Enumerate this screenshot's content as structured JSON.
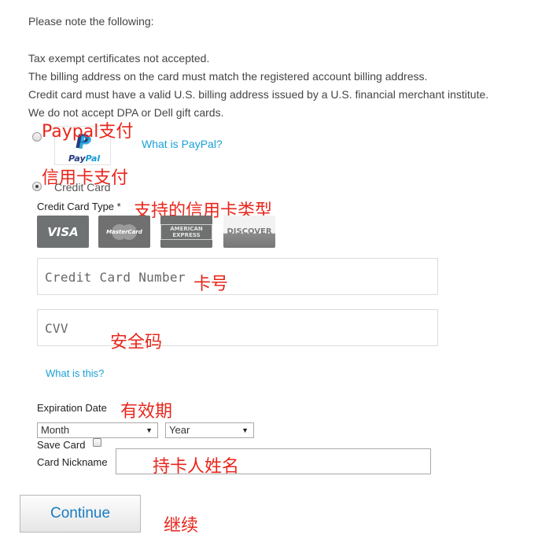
{
  "notes": {
    "heading": "Please note the following:",
    "lines": [
      "Tax exempt certificates not accepted.",
      "The billing address on the card must match the registered account billing address.",
      "Credit card must have a valid U.S. billing address issued by a U.S. financial merchant institute.",
      "We do not accept DPA or Dell gift cards."
    ]
  },
  "annotations": {
    "paypal": "Paypal支付",
    "credit_card": "信用卡支付",
    "card_types": "支持的信用卡类型",
    "card_number": "卡号",
    "cvv": "安全码",
    "expiration": "有效期",
    "nickname": "持卡人姓名",
    "continue": "继续"
  },
  "paypal": {
    "logo_text_pay": "Pay",
    "logo_text_pal": "Pal",
    "what_is_link": "What is PayPal?"
  },
  "credit_card": {
    "radio_label": "Credit Card",
    "type_label": "Credit Card Type *",
    "card_types": [
      "VISA",
      "MasterCard",
      "AMERICAN EXPRESS",
      "DISCOVER"
    ],
    "number_placeholder": "Credit Card Number",
    "cvv_placeholder": "CVV",
    "what_is_this_link": "What is this?",
    "expiration_label": "Expiration Date",
    "month_selected": "Month",
    "year_selected": "Year",
    "save_card_label": "Save Card",
    "nickname_label": "Card Nickname"
  },
  "continue_button": "Continue",
  "colors": {
    "accent_link": "#1aa1d6",
    "annotation_red": "#e8261c",
    "button_text": "#1a7cc2"
  }
}
